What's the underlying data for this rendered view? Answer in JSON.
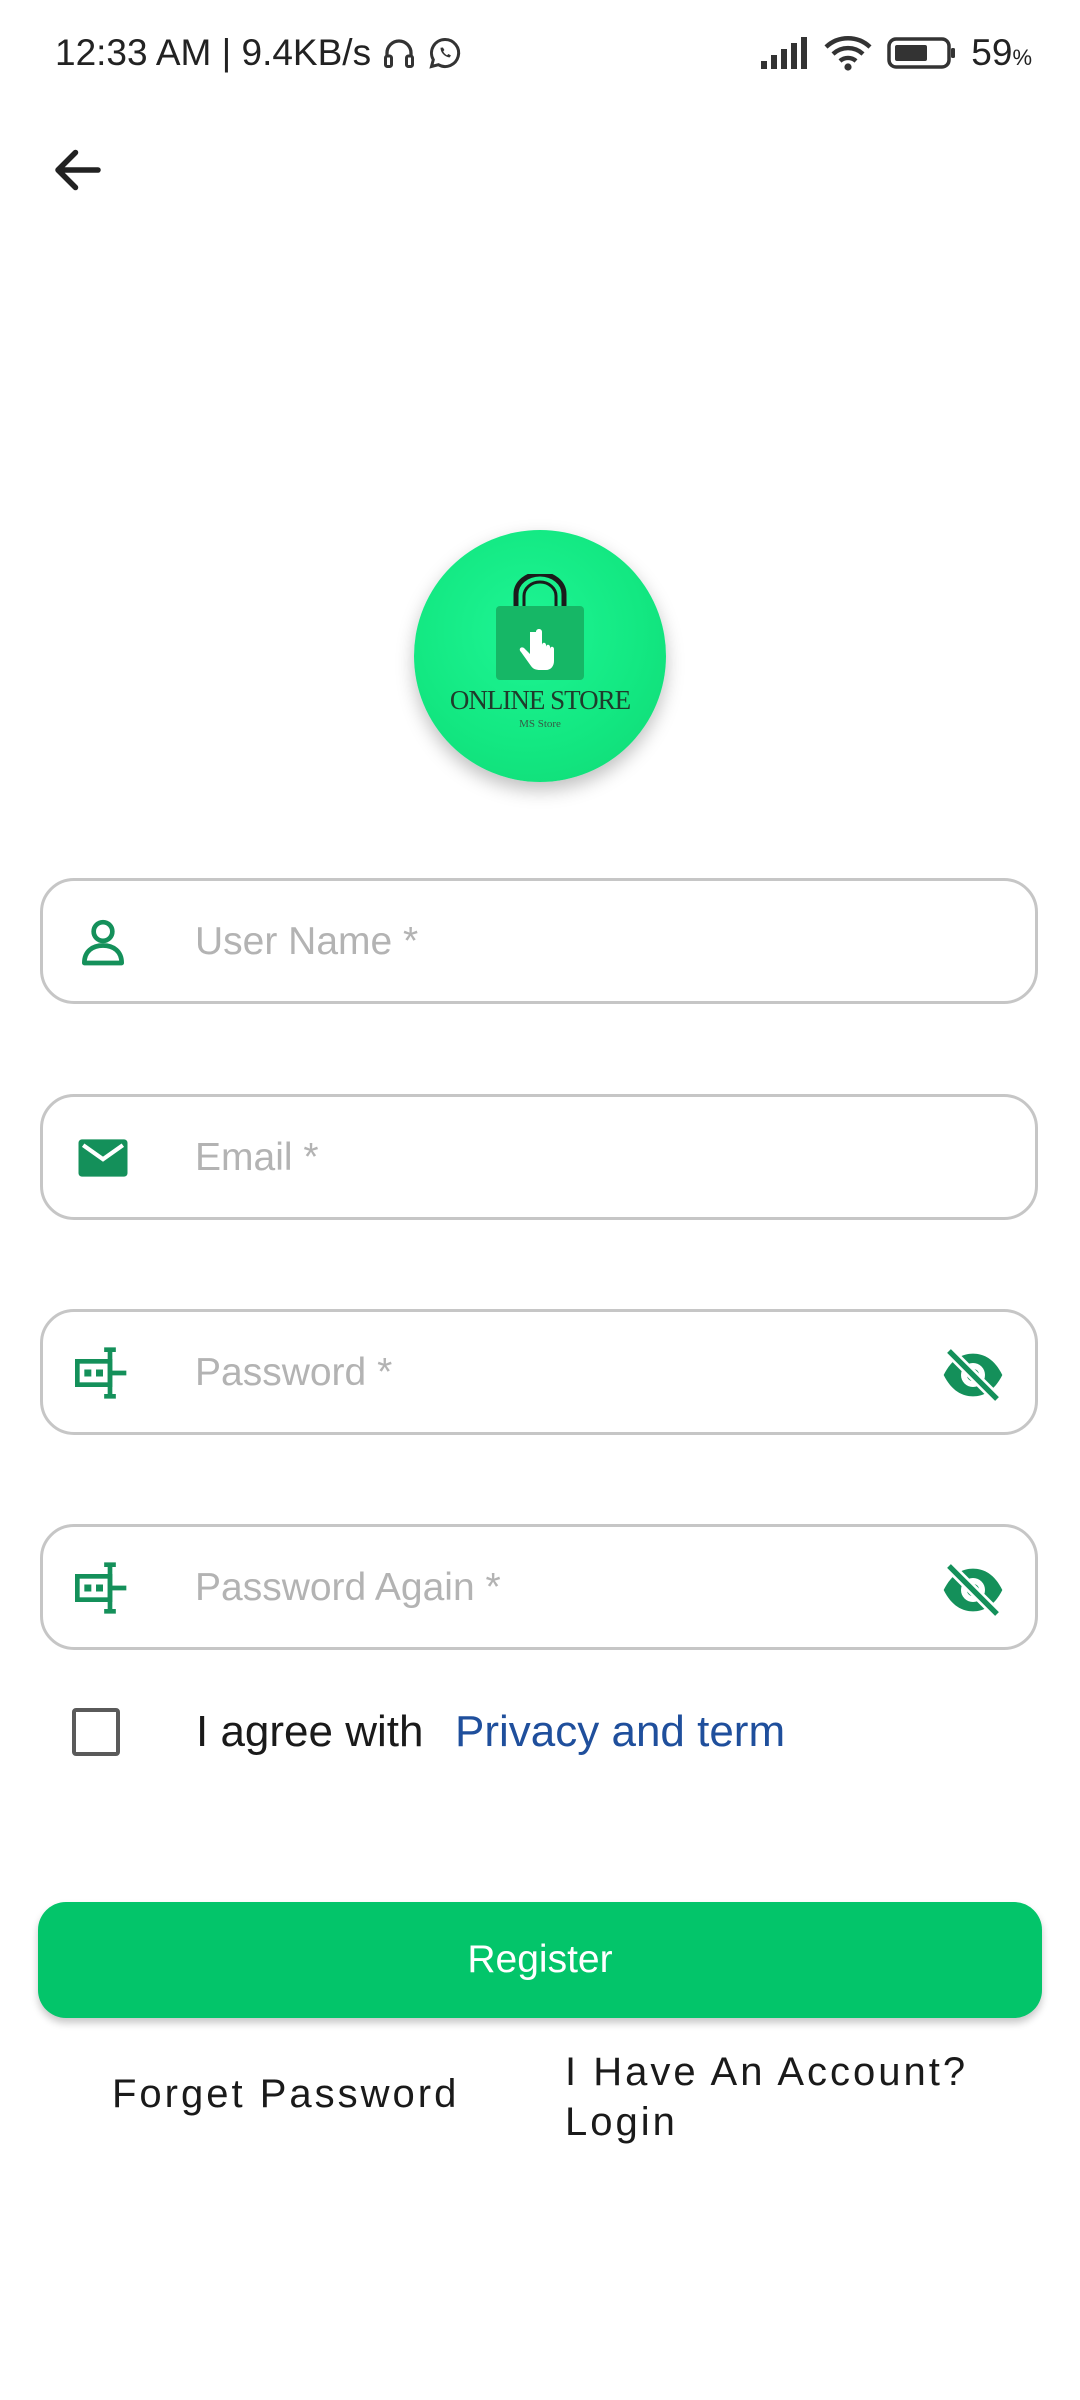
{
  "status_bar": {
    "time": "12:33 AM | 9.4KB/s",
    "battery_percent": "59",
    "battery_unit": "%",
    "icons": [
      "headphones-icon",
      "whatsapp-icon",
      "signal-icon",
      "wifi-icon",
      "battery-icon"
    ]
  },
  "navigation": {
    "back_icon": "arrow-left-icon"
  },
  "logo": {
    "title": "ONLINE STORE",
    "subtitle": "MS Store"
  },
  "form": {
    "username": {
      "placeholder": "User Name *",
      "value": "",
      "icon": "user-icon"
    },
    "email": {
      "placeholder": "Email *",
      "value": "",
      "icon": "mail-icon"
    },
    "password": {
      "placeholder": "Password *",
      "value": "",
      "icon": "password-icon",
      "toggle_icon": "eye-off-icon"
    },
    "password_again": {
      "placeholder": "Password Again *",
      "value": "",
      "icon": "password-icon",
      "toggle_icon": "eye-off-icon"
    }
  },
  "agreement": {
    "text": "I agree with",
    "link": "Privacy and term",
    "checked": false
  },
  "actions": {
    "register_label": "Register",
    "forget_password_label": "Forget Password",
    "login_label": "I Have An Account? Login"
  },
  "colors": {
    "accent": "#03c56a",
    "icon_green": "#14905a",
    "link_blue": "#1f4f9c",
    "placeholder": "#b3b3b3",
    "border": "#c6c6c6"
  }
}
